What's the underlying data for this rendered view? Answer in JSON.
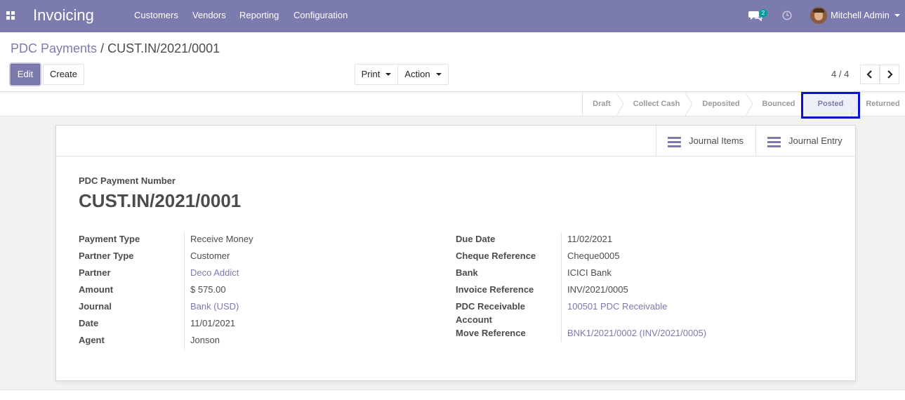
{
  "navbar": {
    "app_title": "Invoicing",
    "menu": [
      "Customers",
      "Vendors",
      "Reporting",
      "Configuration"
    ],
    "chat_count": "2",
    "user_name": "Mitchell Admin",
    "color": "#7c7bad"
  },
  "breadcrumb": {
    "parent": "PDC Payments",
    "separator": "/",
    "current": "CUST.IN/2021/0001"
  },
  "buttons": {
    "edit": "Edit",
    "create": "Create",
    "print": "Print",
    "action": "Action"
  },
  "pager": {
    "value": "4 / 4"
  },
  "statusbar": {
    "stages": [
      "Draft",
      "Collect Cash",
      "Deposited",
      "Bounced",
      "Posted",
      "Returned"
    ],
    "active": "Posted"
  },
  "smart_buttons": {
    "journal_items": "Journal Items",
    "journal_entry": "Journal Entry"
  },
  "form": {
    "title_label": "PDC Payment Number",
    "title": "CUST.IN/2021/0001",
    "left": [
      {
        "label": "Payment Type",
        "value": "Receive Money"
      },
      {
        "label": "Partner Type",
        "value": "Customer"
      },
      {
        "label": "Partner",
        "value": "Deco Addict"
      },
      {
        "label": "Amount",
        "value": "$ 575.00"
      },
      {
        "label": "Journal",
        "value": "Bank (USD)"
      },
      {
        "label": "Date",
        "value": "11/01/2021"
      },
      {
        "label": "Agent",
        "value": "Jonson"
      }
    ],
    "right": [
      {
        "label": "Due Date",
        "value": "11/02/2021"
      },
      {
        "label": "Cheque Reference",
        "value": "Cheque0005"
      },
      {
        "label": "Bank",
        "value": "ICICI Bank"
      },
      {
        "label": "Invoice Reference",
        "value": "INV/2021/0005"
      },
      {
        "label_line1": "PDC Receivable",
        "label_line2": "Account",
        "value": "100501 PDC Receivable"
      },
      {
        "label": "Move Reference",
        "value": "BNK1/2021/0002 (INV/2021/0005)"
      }
    ]
  }
}
